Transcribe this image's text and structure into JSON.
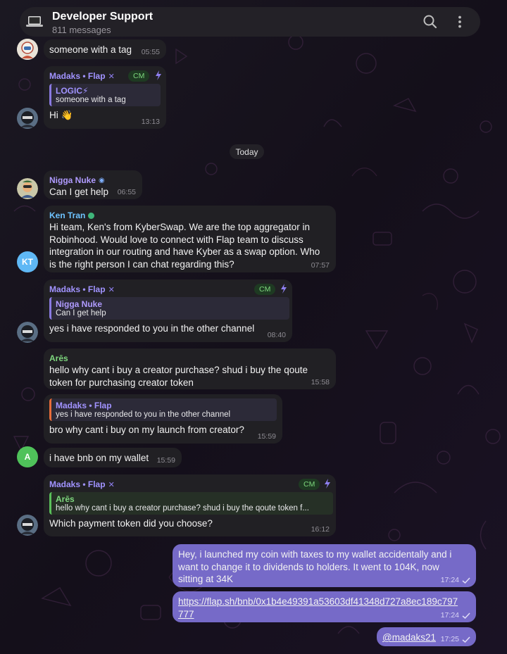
{
  "header": {
    "title": "Developer Support",
    "subtitle": "811 messages"
  },
  "date_separator": "Today",
  "colors": {
    "incoming_bubble": "#212024",
    "outgoing_bubble": "#766ac8",
    "header_bg": "#232127",
    "madaks_name": "#a193ff",
    "nuke_name": "#b09bff",
    "ken_name": "#6ec3ff",
    "ares_name": "#7ed77e"
  },
  "messages": [
    {
      "text": "someone with a tag",
      "time": "05:55"
    },
    {
      "sender": "Madaks • Flap",
      "tag": "CM",
      "reply_name": "LOGIC⚡",
      "reply_text": "someone with a tag",
      "text": "Hi 👋",
      "time": "13:13"
    },
    {
      "sender": "Nigga Nuke",
      "text": "Can I get help",
      "time": "06:55"
    },
    {
      "sender": "Ken Tran",
      "avatar_initials": "KT",
      "lines": [
        "Hi team, Ken's from KyberSwap. We are the top aggregator in",
        "Robinhood. Would love to connect with Flap team to discuss",
        "integration in our routing and have Kyber as a swap option. Who",
        "is the right person I can chat regarding this?"
      ],
      "time": "07:57"
    },
    {
      "sender": "Madaks • Flap",
      "tag": "CM",
      "reply_name": "Nigga Nuke",
      "reply_text": "Can I get help",
      "text": "yes i have responded to you in the other channel",
      "time": "08:40"
    },
    {
      "sender": "Arēs",
      "lines": [
        "hello why cant i buy a creator purchase? shud i buy the qoute",
        "token for purchasing creator token"
      ],
      "time": "15:58"
    },
    {
      "reply_name": "Madaks • Flap",
      "reply_text": "yes i have responded to you in the other channel",
      "text": "bro why cant i buy on my launch from creator?",
      "time": "15:59"
    },
    {
      "avatar_initials": "A",
      "text": "i have bnb on my wallet",
      "time": "15:59"
    },
    {
      "sender": "Madaks • Flap",
      "tag": "CM",
      "reply_name": "Arēs",
      "reply_text": "hello why cant i buy a creator purchase? shud i buy the qoute token f...",
      "text": "Which payment token did you choose?",
      "time": "16:12"
    },
    {
      "lines": [
        "Hey, i launched my coin with taxes to my wallet accidentally and i",
        "want to change it to dividends to holders. It went to 104K, now",
        "sitting at 34K"
      ],
      "time": "17:24"
    },
    {
      "lines": [
        "https://flap.sh/bnb/0x1b4e49391a53603df41348d727a8ec189c797",
        "777"
      ],
      "time": "17:24"
    },
    {
      "text": "@madaks21",
      "time": "17:25"
    }
  ]
}
